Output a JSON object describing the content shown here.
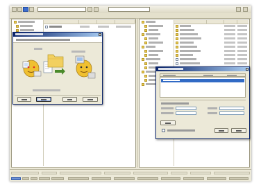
{
  "window": {
    "title": ""
  },
  "toolbar": {
    "path_value": "",
    "search_value": ""
  },
  "left_pane": {
    "tree_items": [
      "",
      "",
      "",
      "",
      "",
      ""
    ],
    "columns": [
      "",
      "",
      "",
      ""
    ],
    "file_rows": [
      {
        "name": "",
        "size": "",
        "type": "",
        "modified": ""
      }
    ]
  },
  "right_pane": {
    "tree_items": [
      "",
      "",
      "",
      "",
      "",
      "",
      "",
      "",
      "",
      "",
      "",
      "",
      "",
      "",
      "",
      ""
    ],
    "columns": [
      "",
      "",
      "",
      ""
    ],
    "file_rows": [
      {
        "name": "",
        "date": "",
        "time": ""
      },
      {
        "name": "",
        "date": "",
        "time": ""
      },
      {
        "name": "",
        "date": "",
        "time": ""
      },
      {
        "name": "",
        "date": "",
        "time": ""
      },
      {
        "name": "",
        "date": "",
        "time": ""
      },
      {
        "name": "",
        "date": "",
        "time": ""
      },
      {
        "name": "",
        "date": "",
        "time": ""
      },
      {
        "name": "",
        "date": "",
        "time": ""
      },
      {
        "name": "",
        "date": "",
        "time": ""
      },
      {
        "name": "",
        "date": "",
        "time": ""
      },
      {
        "name": "",
        "date": "",
        "time": ""
      },
      {
        "name": "",
        "date": "",
        "time": ""
      },
      {
        "name": "",
        "date": "",
        "time": ""
      }
    ]
  },
  "wizard_dialog": {
    "title": "",
    "intro": "",
    "caption_left": "",
    "caption_right": "",
    "footer_note": "",
    "buttons": {
      "back": "",
      "next": "",
      "cancel": "",
      "help": ""
    }
  },
  "transfer_dialog": {
    "title": "",
    "columns": [
      "",
      "",
      ""
    ],
    "selected_item": "",
    "details_label": "",
    "field_labels": [
      "",
      "",
      "",
      ""
    ],
    "checkbox_label": "",
    "buttons": {
      "primary": "",
      "ok": "",
      "cancel": ""
    }
  },
  "statusbar": {
    "segments": [
      "",
      "",
      "",
      "",
      "",
      "",
      "",
      "",
      "",
      "",
      "",
      "",
      ""
    ]
  },
  "colors": {
    "window_bg": "#ece9d8",
    "titlebar_start": "#0a246a",
    "titlebar_end": "#a6caf0",
    "selection": "#316ac5",
    "folder": "#e8c850"
  }
}
